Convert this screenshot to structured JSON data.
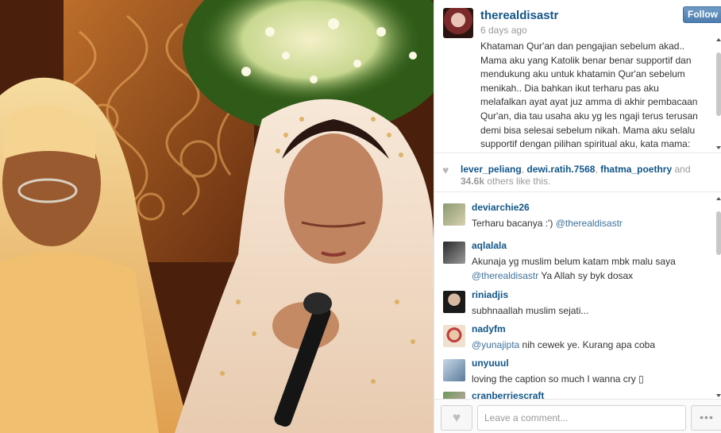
{
  "post": {
    "owner_username": "therealdisastr",
    "time_ago": "6 days ago",
    "follow_label": "Follow",
    "caption_lines": [
      "Khataman Qur'an dan pengajian sebelum akad..",
      "Mama aku yang Katolik benar benar supportif dan",
      "mendukung aku untuk khatamin Qur'an sebelum",
      "menikah.. Dia bahkan ikut terharu pas aku",
      "melafalkan ayat ayat juz amma di akhir pembacaan",
      "Qur'an, dia tau usaha aku yg les ngaji terus terusan",
      "demi bisa selesai sebelum nikah. Mama aku selalu",
      "supportif dengan pilihan spiritual aku, kata mama:"
    ]
  },
  "likes": {
    "users": [
      "lever_peliang",
      "dewi.ratih.7568",
      "fhatma_poethry"
    ],
    "sep1": ", ",
    "sep2": ", ",
    "and_text": " and ",
    "count": "34.6k",
    "suffix": " others like this."
  },
  "comments": [
    {
      "user": "deviarchie26",
      "text": "Terharu bacanya :') ",
      "mention": "@therealdisastr",
      "after": ""
    },
    {
      "user": "aqlalala",
      "text": "Akunaja yg muslim belum katam mbk malu saya ",
      "mention": "@therealdisastr",
      "after": " Ya Allah sy byk dosax"
    },
    {
      "user": "riniadjis",
      "text": "subhnaallah muslim sejati...",
      "mention": "",
      "after": ""
    },
    {
      "user": "nadyfm",
      "text": "",
      "mention": "@yunajipta",
      "after": " nih cewek ye. Kurang apa coba"
    },
    {
      "user": "unyuuul",
      "text": "loving the caption so much I wanna cry ▯",
      "mention": "",
      "after": ""
    },
    {
      "user": "cranberriescraft",
      "text": "",
      "mention": "",
      "after": ""
    }
  ],
  "footer": {
    "comment_placeholder": "Leave a comment...",
    "like_icon": "heart-icon",
    "more_label": "•••"
  },
  "colors": {
    "username": "#125688",
    "mention": "#3f729b",
    "follow_button": "#5b8bbc"
  }
}
